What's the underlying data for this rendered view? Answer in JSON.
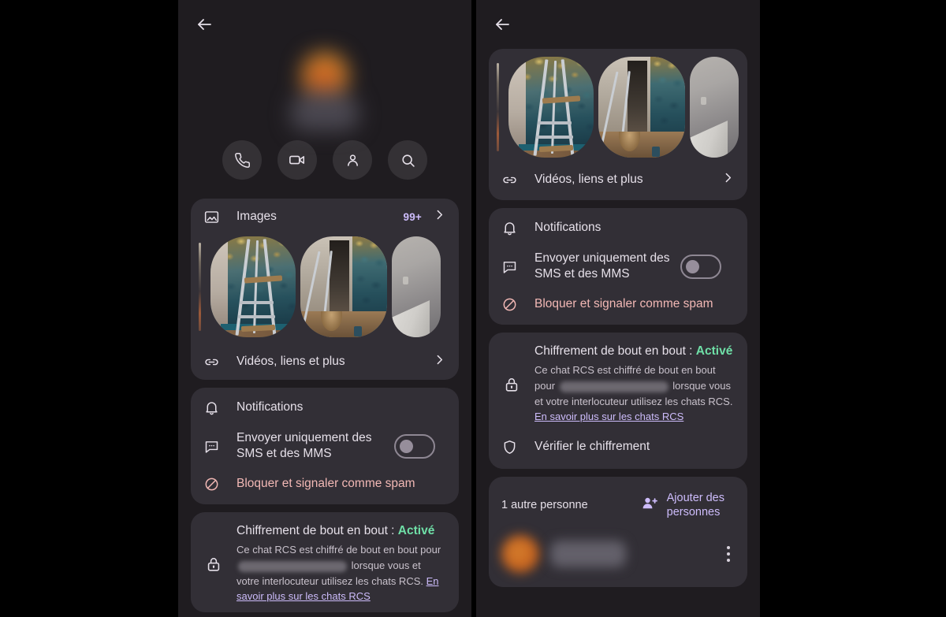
{
  "left_panel": {
    "back_icon": "arrow-back-icon",
    "avatar": "contact-avatar-blurred",
    "actions": [
      {
        "icon": "phone-icon",
        "name": "call"
      },
      {
        "icon": "video-camera-icon",
        "name": "video-call"
      },
      {
        "icon": "person-icon",
        "name": "contact-details"
      },
      {
        "icon": "search-icon",
        "name": "search-conversation"
      }
    ],
    "images_card": {
      "icon": "image-icon",
      "label": "Images",
      "badge": "99+",
      "chevron": "chevron-right-icon",
      "thumbnails": [
        "room-with-ladder-teal-wallpaper",
        "hallway-with-ladder-and-stool",
        "white-wall-with-sheet"
      ],
      "more_row": {
        "icon": "link-icon",
        "label": "Vidéos, liens et plus",
        "chevron": "chevron-right-icon"
      }
    },
    "notifications_card": {
      "title": "Notifications",
      "title_icon": "bell-icon",
      "sms_only": {
        "icon": "chat-bubble-icon",
        "label": "Envoyer uniquement des SMS et des MMS",
        "toggle_state": "off"
      },
      "block_spam": {
        "icon": "block-icon",
        "label": "Bloquer et signaler comme spam",
        "color": "#F2B8B5"
      }
    },
    "encryption_card": {
      "icon": "lock-icon",
      "title_prefix": "Chiffrement de bout en bout : ",
      "status": "Activé",
      "status_color": "#6FDFA7",
      "body_part1": "Ce chat RCS est chiffré de bout en bout pour ",
      "redacted": "",
      "body_part2": " lorsque vous et votre interlocuteur utilisez les chats RCS. ",
      "link": "En savoir plus sur les chats RCS"
    }
  },
  "right_panel": {
    "back_icon": "arrow-back-icon",
    "images_card": {
      "thumbnails": [
        "room-with-ladder-teal-wallpaper",
        "hallway-with-ladder-and-stool",
        "white-wall-with-sheet"
      ],
      "more_row": {
        "icon": "link-icon",
        "label": "Vidéos, liens et plus",
        "chevron": "chevron-right-icon"
      }
    },
    "notifications_card": {
      "title": "Notifications",
      "title_icon": "bell-icon",
      "sms_only": {
        "icon": "chat-bubble-icon",
        "label": "Envoyer uniquement des SMS et des MMS",
        "toggle_state": "off"
      },
      "block_spam": {
        "icon": "block-icon",
        "label": "Bloquer et signaler comme spam",
        "color": "#F2B8B5"
      }
    },
    "encryption_card": {
      "icon": "lock-icon",
      "title_prefix": "Chiffrement de bout en bout : ",
      "status": "Activé",
      "status_color": "#6FDFA7",
      "body_part1": "Ce chat RCS est chiffré de bout en bout pour ",
      "body_part2": " lorsque vous et votre interlocuteur utilisez les chats RCS. ",
      "link": "En savoir plus sur les chats RCS",
      "verify_row": {
        "icon": "shield-icon",
        "label": "Vérifier le chiffrement"
      }
    },
    "people_card": {
      "count_label": "1 autre personne",
      "add_icon": "person-add-icon",
      "add_label": "Ajouter des personnes",
      "person": {
        "avatar": "person-avatar-blurred",
        "name_redacted": "",
        "menu_icon": "more-vert-icon"
      }
    }
  },
  "theme": {
    "page_bg": "#000000",
    "phone_bg": "#1F1C20",
    "card_bg": "#322F36",
    "text_primary": "#E6E0E9",
    "text_secondary": "#C9C2CC",
    "accent": "#CDBCFB",
    "success": "#6FDFA7",
    "danger": "#F2B8B5"
  }
}
